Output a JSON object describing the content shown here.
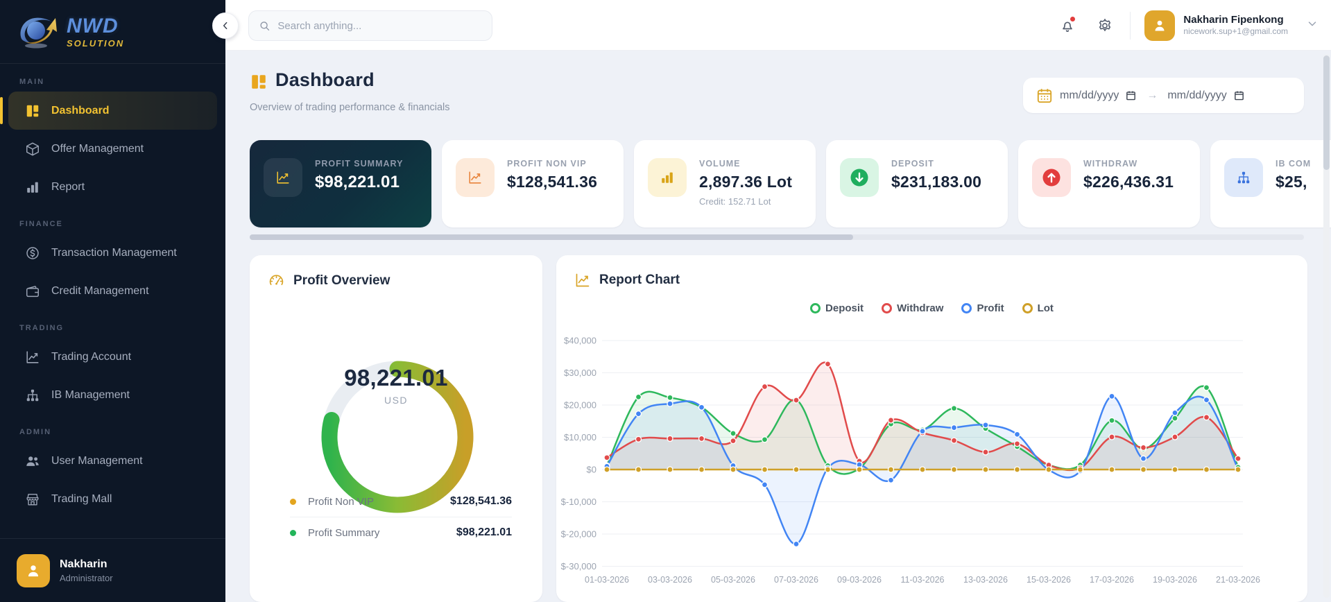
{
  "sidebar": {
    "logo": {
      "title": "NWD",
      "subtitle": "SOLUTION"
    },
    "sections": [
      {
        "label": "MAIN",
        "items": [
          {
            "label": "Dashboard",
            "icon": "dashboard-grid-icon",
            "active": true
          },
          {
            "label": "Offer Management",
            "icon": "box-icon",
            "active": false
          },
          {
            "label": "Report",
            "icon": "bar-chart-icon",
            "active": false
          }
        ]
      },
      {
        "label": "FINANCE",
        "items": [
          {
            "label": "Transaction Management",
            "icon": "dollar-circle-icon",
            "active": false
          },
          {
            "label": "Credit Management",
            "icon": "wallet-icon",
            "active": false
          }
        ]
      },
      {
        "label": "TRADING",
        "items": [
          {
            "label": "Trading Account",
            "icon": "line-chart-icon",
            "active": false
          },
          {
            "label": "IB Management",
            "icon": "hierarchy-icon",
            "active": false
          }
        ]
      },
      {
        "label": "ADMIN",
        "items": [
          {
            "label": "User Management",
            "icon": "users-icon",
            "active": false
          },
          {
            "label": "Trading Mall",
            "icon": "store-icon",
            "active": false
          }
        ]
      }
    ],
    "user": {
      "name": "Nakharin",
      "role": "Administrator"
    }
  },
  "topbar": {
    "search_placeholder": "Search anything...",
    "user": {
      "name": "Nakharin Fipenkong",
      "email": "nicework.sup+1@gmail.com"
    }
  },
  "header": {
    "title": "Dashboard",
    "subtitle": "Overview of trading performance & financials",
    "date_from_placeholder": "mm/dd/yyyy",
    "date_to_placeholder": "mm/dd/yyyy",
    "date_separator": "→"
  },
  "stat_cards": [
    {
      "label": "PROFIT SUMMARY",
      "value": "$98,221.01",
      "sub": "",
      "icon": "line-chart-icon",
      "theme": "dark",
      "icon_color": "#f2c231",
      "icon_bg": "rgba(255,255,255,0.08)"
    },
    {
      "label": "PROFIT NON VIP",
      "value": "$128,541.36",
      "sub": "",
      "icon": "line-chart-icon",
      "theme": "light",
      "icon_color": "#e8833a",
      "icon_bg": "#fdeada"
    },
    {
      "label": "VOLUME",
      "value": "2,897.36 Lot",
      "sub": "Credit: 152.71 Lot",
      "icon": "bar-chart-icon",
      "theme": "light",
      "icon_color": "#d9a418",
      "icon_bg": "#fcf3d6"
    },
    {
      "label": "DEPOSIT",
      "value": "$231,183.00",
      "sub": "",
      "icon": "arrow-down-circle-icon",
      "theme": "light",
      "icon_color": "#1fae5e",
      "icon_bg": "#d9f5e4"
    },
    {
      "label": "WITHDRAW",
      "value": "$226,436.31",
      "sub": "",
      "icon": "arrow-up-circle-icon",
      "theme": "light",
      "icon_color": "#e23d3d",
      "icon_bg": "#fde2e0"
    },
    {
      "label": "IB COM",
      "value": "$25,",
      "sub": "",
      "icon": "hierarchy-icon",
      "theme": "light",
      "icon_color": "#3a72dd",
      "icon_bg": "#dfe9fa"
    }
  ],
  "chart_data": [
    {
      "type": "donut",
      "title": "Profit Overview",
      "center_value": "98,221.01",
      "center_unit": "USD",
      "ring": {
        "colored_fraction": 0.79,
        "gradient": [
          "#2fb34c",
          "#8abb35",
          "#c89f28"
        ],
        "track_color": "#e9edf2"
      },
      "segments": [
        {
          "label": "Profit Non VIP",
          "value": 128541.36,
          "display": "$128,541.36",
          "color": "#e3a51f"
        },
        {
          "label": "Profit Summary",
          "value": 98221.01,
          "display": "$98,221.01",
          "color": "#22b55a"
        }
      ]
    },
    {
      "type": "line",
      "title": "Report Chart",
      "x": [
        "01-03-2026",
        "02-03-2026",
        "03-03-2026",
        "04-03-2026",
        "05-03-2026",
        "06-03-2026",
        "07-03-2026",
        "08-03-2026",
        "09-03-2026",
        "10-03-2026",
        "11-03-2026",
        "12-03-2026",
        "13-03-2026",
        "14-03-2026",
        "15-03-2026",
        "16-03-2026",
        "17-03-2026",
        "18-03-2026",
        "19-03-2026",
        "20-03-2026",
        "21-03-2026"
      ],
      "x_labels_shown": [
        "01-03-2026",
        "03-03-2026",
        "05-03-2026",
        "07-03-2026",
        "09-03-2026",
        "11-03-2026",
        "13-03-2026",
        "15-03-2026",
        "17-03-2026",
        "19-03-2026",
        "21-03-2026"
      ],
      "ylim": [
        -30000,
        40000
      ],
      "ytick_values": [
        40000,
        30000,
        20000,
        10000,
        0,
        -10000,
        -20000,
        -30000
      ],
      "ytick_labels": [
        "$40,000",
        "$30,000",
        "$20,000",
        "$10,000",
        "$0",
        "$-10,000",
        "$-20,000",
        "$-30,000"
      ],
      "grid": true,
      "legend_position": "top-center",
      "series": [
        {
          "name": "Deposit",
          "color": "#2eb85c",
          "values": [
            1200,
            22500,
            22300,
            19300,
            11200,
            9300,
            21600,
            1200,
            300,
            14100,
            12300,
            19000,
            12700,
            7100,
            1400,
            1400,
            15200,
            6400,
            15900,
            25400,
            700
          ]
        },
        {
          "name": "Withdraw",
          "color": "#e14b4b",
          "values": [
            3700,
            9400,
            9600,
            9600,
            8900,
            25700,
            21500,
            32700,
            2600,
            15300,
            11400,
            9000,
            5400,
            8000,
            1400,
            500,
            10100,
            6800,
            10100,
            16200,
            3400
          ]
        },
        {
          "name": "Profit",
          "color": "#4285f4",
          "values": [
            1000,
            17300,
            20400,
            19300,
            1200,
            -4700,
            -23100,
            400,
            1500,
            -3300,
            11900,
            13000,
            13800,
            10900,
            -100,
            -400,
            22700,
            3400,
            17600,
            21600,
            0
          ]
        },
        {
          "name": "Lot",
          "color": "#cfa028",
          "values": [
            0,
            0,
            0,
            0,
            0,
            0,
            0,
            0,
            0,
            0,
            0,
            0,
            0,
            0,
            0,
            0,
            0,
            0,
            0,
            0,
            0
          ]
        }
      ]
    }
  ]
}
